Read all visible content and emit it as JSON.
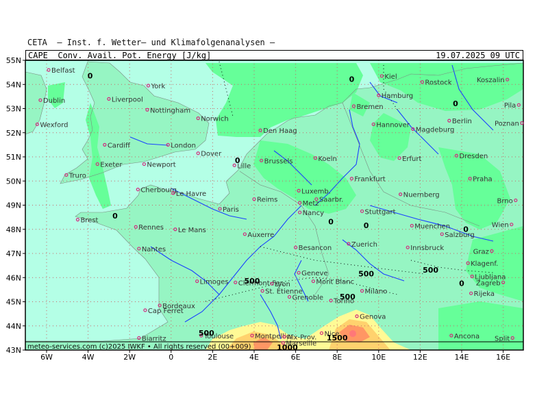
{
  "header": {
    "institute": "CETA  — Inst. f. Wetter— und Klimafolgenanalysen —",
    "parameter": "CAPE  Conv. Avail. Pot. Energy [J/kg]",
    "datetime": "19.07.2025 09 UTC"
  },
  "footer": {
    "credit": "meteo-services.com  (c)2025 IWKF  •  All rights reserved  (00+009)"
  },
  "colors": {
    "sea": "#b4ffe6",
    "land_low": "#96f5c3",
    "land_mid": "#66ff99",
    "land_green": "#50e68c",
    "cape_500": "#fffa96",
    "cape_1000": "#ffd26e",
    "cape_1500": "#ff9664",
    "cape_2000": "#ff7878",
    "rivers": "#1a40ff",
    "grid": "#c86464",
    "city_marker": "#d2287d"
  },
  "axes": {
    "lat_labels": [
      "55N",
      "54N",
      "53N",
      "52N",
      "51N",
      "50N",
      "49N",
      "48N",
      "47N",
      "46N",
      "45N",
      "44N",
      "43N"
    ],
    "lon_labels": [
      "6W",
      "4W",
      "2W",
      "0",
      "2E",
      "4E",
      "6E",
      "8E",
      "10E",
      "12E",
      "14E",
      "16E"
    ]
  },
  "contour_labels": [
    {
      "text": "0",
      "lon": -3.9,
      "lat": 54.25
    },
    {
      "text": "0",
      "lon": 8.7,
      "lat": 54.1
    },
    {
      "text": "0",
      "lon": 13.7,
      "lat": 53.1
    },
    {
      "text": "0",
      "lon": 3.2,
      "lat": 50.75
    },
    {
      "text": "0",
      "lon": -2.7,
      "lat": 48.45
    },
    {
      "text": "0",
      "lon": 7.7,
      "lat": 48.2
    },
    {
      "text": "0",
      "lon": 9.4,
      "lat": 48.05
    },
    {
      "text": "0",
      "lon": 14.2,
      "lat": 47.9
    },
    {
      "text": "0",
      "lon": 14.0,
      "lat": 45.65
    },
    {
      "text": "500",
      "lon": 3.9,
      "lat": 45.75
    },
    {
      "text": "500",
      "lon": 9.4,
      "lat": 46.05
    },
    {
      "text": "500",
      "lon": 12.5,
      "lat": 46.2
    },
    {
      "text": "500",
      "lon": 8.5,
      "lat": 45.1
    },
    {
      "text": "500",
      "lon": 1.7,
      "lat": 43.6
    },
    {
      "text": "1500",
      "lon": 8.0,
      "lat": 43.4
    },
    {
      "text": "1000",
      "lon": 5.6,
      "lat": 43.0
    }
  ],
  "cities": [
    {
      "name": "Belfast",
      "lon": -5.9,
      "lat": 54.6
    },
    {
      "name": "Dublin",
      "lon": -6.3,
      "lat": 53.35
    },
    {
      "name": "Wexford",
      "lon": -6.45,
      "lat": 52.35
    },
    {
      "name": "Liverpool",
      "lon": -3.0,
      "lat": 53.4
    },
    {
      "name": "York",
      "lon": -1.1,
      "lat": 53.95
    },
    {
      "name": "Nottingham",
      "lon": -1.15,
      "lat": 52.95
    },
    {
      "name": "Norwich",
      "lon": 1.3,
      "lat": 52.6
    },
    {
      "name": "Cardiff",
      "lon": -3.2,
      "lat": 51.5
    },
    {
      "name": "London",
      "lon": -0.15,
      "lat": 51.5
    },
    {
      "name": "Dover",
      "lon": 1.3,
      "lat": 51.15
    },
    {
      "name": "Exeter",
      "lon": -3.55,
      "lat": 50.7
    },
    {
      "name": "Truro",
      "lon": -5.05,
      "lat": 50.25
    },
    {
      "name": "Newport",
      "lon": -1.3,
      "lat": 50.7
    },
    {
      "name": "Cherbourg",
      "lon": -1.6,
      "lat": 49.65
    },
    {
      "name": "Le Havre",
      "lon": 0.1,
      "lat": 49.5
    },
    {
      "name": "Brest",
      "lon": -4.5,
      "lat": 48.4
    },
    {
      "name": "Rennes",
      "lon": -1.7,
      "lat": 48.1
    },
    {
      "name": "Le Mans",
      "lon": 0.2,
      "lat": 48.0
    },
    {
      "name": "Nantes",
      "lon": -1.55,
      "lat": 47.2
    },
    {
      "name": "Paris",
      "lon": 2.35,
      "lat": 48.85
    },
    {
      "name": "Reims",
      "lon": 4.0,
      "lat": 49.25
    },
    {
      "name": "Lille",
      "lon": 3.05,
      "lat": 50.65
    },
    {
      "name": "Brussels",
      "lon": 4.35,
      "lat": 50.85
    },
    {
      "name": "Den Haag",
      "lon": 4.3,
      "lat": 52.1
    },
    {
      "name": "Koeln",
      "lon": 6.95,
      "lat": 50.95
    },
    {
      "name": "Luxemb.",
      "lon": 6.15,
      "lat": 49.6
    },
    {
      "name": "Metz",
      "lon": 6.2,
      "lat": 49.1
    },
    {
      "name": "Saarbr.",
      "lon": 7.0,
      "lat": 49.25
    },
    {
      "name": "Nancy",
      "lon": 6.2,
      "lat": 48.7
    },
    {
      "name": "Auxerre",
      "lon": 3.55,
      "lat": 47.8
    },
    {
      "name": "Besancon",
      "lon": 6.0,
      "lat": 47.25
    },
    {
      "name": "Limoges",
      "lon": 1.25,
      "lat": 45.85
    },
    {
      "name": "Clermont-Fer.",
      "lon": 3.1,
      "lat": 45.8
    },
    {
      "name": "Lyon",
      "lon": 4.85,
      "lat": 45.75
    },
    {
      "name": "Geneve",
      "lon": 6.15,
      "lat": 46.2
    },
    {
      "name": "Mont Blanc",
      "lon": 6.85,
      "lat": 45.85
    },
    {
      "name": "Grenoble",
      "lon": 5.7,
      "lat": 45.2
    },
    {
      "name": "St. Etienne",
      "lon": 4.4,
      "lat": 45.45
    },
    {
      "name": "Bordeaux",
      "lon": -0.55,
      "lat": 44.85
    },
    {
      "name": "Cap Ferret",
      "lon": -1.25,
      "lat": 44.65
    },
    {
      "name": "Biarritz",
      "lon": -1.55,
      "lat": 43.5
    },
    {
      "name": "Toulouse",
      "lon": 1.45,
      "lat": 43.6
    },
    {
      "name": "Montpellier",
      "lon": 3.9,
      "lat": 43.6
    },
    {
      "name": "Aix-Prov.",
      "lon": 5.45,
      "lat": 43.55
    },
    {
      "name": "Marseille",
      "lon": 5.4,
      "lat": 43.3
    },
    {
      "name": "Nice",
      "lon": 7.25,
      "lat": 43.7
    },
    {
      "name": "Torino",
      "lon": 7.7,
      "lat": 45.05
    },
    {
      "name": "Genova",
      "lon": 8.95,
      "lat": 44.4
    },
    {
      "name": "Milano",
      "lon": 9.2,
      "lat": 45.45
    },
    {
      "name": "Zuerich",
      "lon": 8.55,
      "lat": 47.4
    },
    {
      "name": "Stuttgart",
      "lon": 9.2,
      "lat": 48.75
    },
    {
      "name": "Frankfurt",
      "lon": 8.7,
      "lat": 50.1
    },
    {
      "name": "Erfurt",
      "lon": 11.0,
      "lat": 50.95
    },
    {
      "name": "Nuernberg",
      "lon": 11.05,
      "lat": 49.45
    },
    {
      "name": "Muenchen",
      "lon": 11.6,
      "lat": 48.15
    },
    {
      "name": "Salzburg",
      "lon": 13.05,
      "lat": 47.8
    },
    {
      "name": "Innsbruck",
      "lon": 11.4,
      "lat": 47.25
    },
    {
      "name": "Hamburg",
      "lon": 10.0,
      "lat": 53.55
    },
    {
      "name": "Bremen",
      "lon": 8.8,
      "lat": 53.1
    },
    {
      "name": "Hannover",
      "lon": 9.75,
      "lat": 52.35
    },
    {
      "name": "Magdeburg",
      "lon": 11.65,
      "lat": 52.15
    },
    {
      "name": "Berlin",
      "lon": 13.4,
      "lat": 52.5
    },
    {
      "name": "Kiel",
      "lon": 10.15,
      "lat": 54.35
    },
    {
      "name": "Rostock",
      "lon": 12.1,
      "lat": 54.1
    },
    {
      "name": "Dresden",
      "lon": 13.75,
      "lat": 51.05
    },
    {
      "name": "Praha",
      "lon": 14.4,
      "lat": 50.1
    },
    {
      "name": "Brno",
      "lon": 16.6,
      "lat": 49.2
    },
    {
      "name": "Wien",
      "lon": 16.4,
      "lat": 48.2
    },
    {
      "name": "Graz",
      "lon": 15.45,
      "lat": 47.1
    },
    {
      "name": "Klagenf.",
      "lon": 14.3,
      "lat": 46.6
    },
    {
      "name": "Ljubljana",
      "lon": 14.5,
      "lat": 46.05
    },
    {
      "name": "Zagreb",
      "lon": 16.0,
      "lat": 45.8
    },
    {
      "name": "Rijeka",
      "lon": 14.45,
      "lat": 45.35
    },
    {
      "name": "Ancona",
      "lon": 13.5,
      "lat": 43.6
    },
    {
      "name": "Split",
      "lon": 16.45,
      "lat": 43.5
    },
    {
      "name": "Koszalin",
      "lon": 16.2,
      "lat": 54.2
    },
    {
      "name": "Pila",
      "lon": 16.75,
      "lat": 53.15
    },
    {
      "name": "Poznan",
      "lon": 16.9,
      "lat": 52.4
    }
  ]
}
